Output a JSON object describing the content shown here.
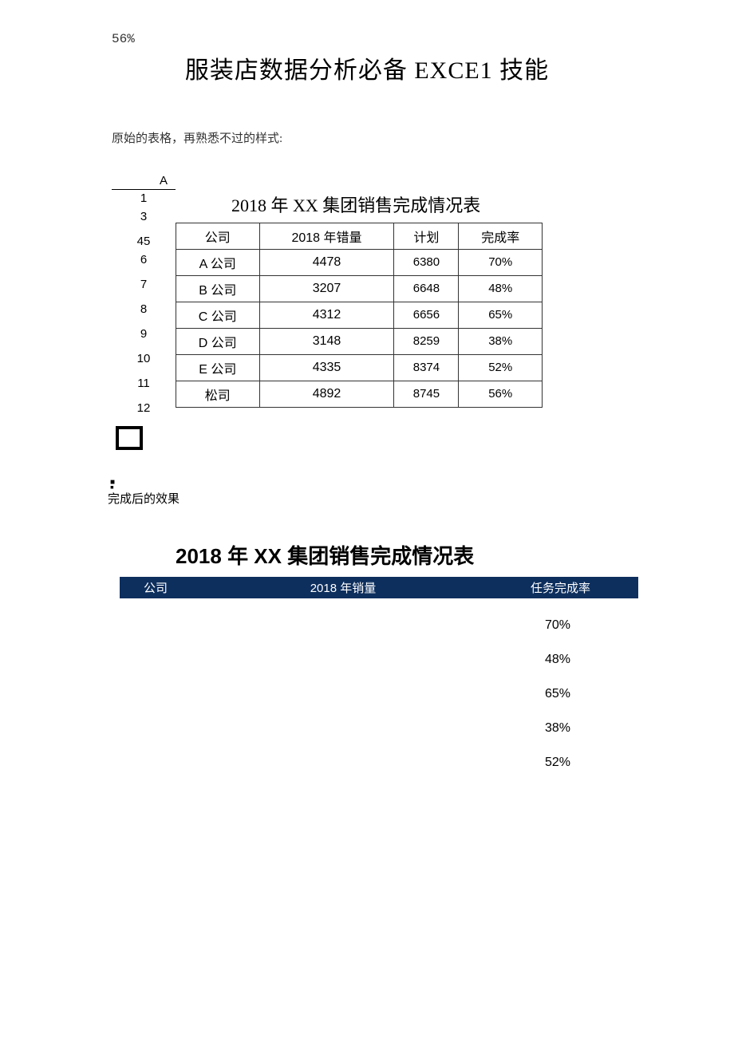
{
  "top_number": "56%",
  "main_title": "服装店数据分析必备 EXCE1 技能",
  "intro_text": "原始的表格，再熟悉不过的样式:",
  "col_letter": "A",
  "row_numbers": [
    "1",
    "3",
    "45",
    "6",
    "7",
    "8",
    "9",
    "10",
    "11",
    "12"
  ],
  "table1_title": "2018 年 XX 集团销售完成情况表",
  "table1": {
    "headers": [
      "公司",
      "2018 年错量",
      "计划",
      "完成率"
    ],
    "rows": [
      [
        "A 公司",
        "4478",
        "6380",
        "70%"
      ],
      [
        "B 公司",
        "3207",
        "6648",
        "48%"
      ],
      [
        "C 公司",
        "4312",
        "6656",
        "65%"
      ],
      [
        "D 公司",
        "3148",
        "8259",
        "38%"
      ],
      [
        "E 公司",
        "4335",
        "8374",
        "52%"
      ],
      [
        "松司",
        "4892",
        "8745",
        "56%"
      ]
    ]
  },
  "after_label": "完成后的效果",
  "table2_title": "2018 年 XX 集团销售完成情况表",
  "table2": {
    "headers": [
      "公司",
      "2018 年销量",
      "任务完成率"
    ],
    "rates": [
      "70%",
      "48%",
      "65%",
      "38%",
      "52%"
    ]
  },
  "chart_data": {
    "type": "table",
    "title": "2018 年 XX 集团销售完成情况表",
    "columns": [
      "公司",
      "2018 年错量",
      "计划",
      "完成率"
    ],
    "rows": [
      {
        "公司": "A 公司",
        "2018 年错量": 4478,
        "计划": 6380,
        "完成率": "70%"
      },
      {
        "公司": "B 公司",
        "2018 年错量": 3207,
        "计划": 6648,
        "完成率": "48%"
      },
      {
        "公司": "C 公司",
        "2018 年错量": 4312,
        "计划": 6656,
        "完成率": "65%"
      },
      {
        "公司": "D 公司",
        "2018 年错量": 3148,
        "计划": 8259,
        "完成率": "38%"
      },
      {
        "公司": "E 公司",
        "2018 年错量": 4335,
        "计划": 8374,
        "完成率": "52%"
      },
      {
        "公司": "松司",
        "2018 年错量": 4892,
        "计划": 8745,
        "完成率": "56%"
      }
    ]
  }
}
